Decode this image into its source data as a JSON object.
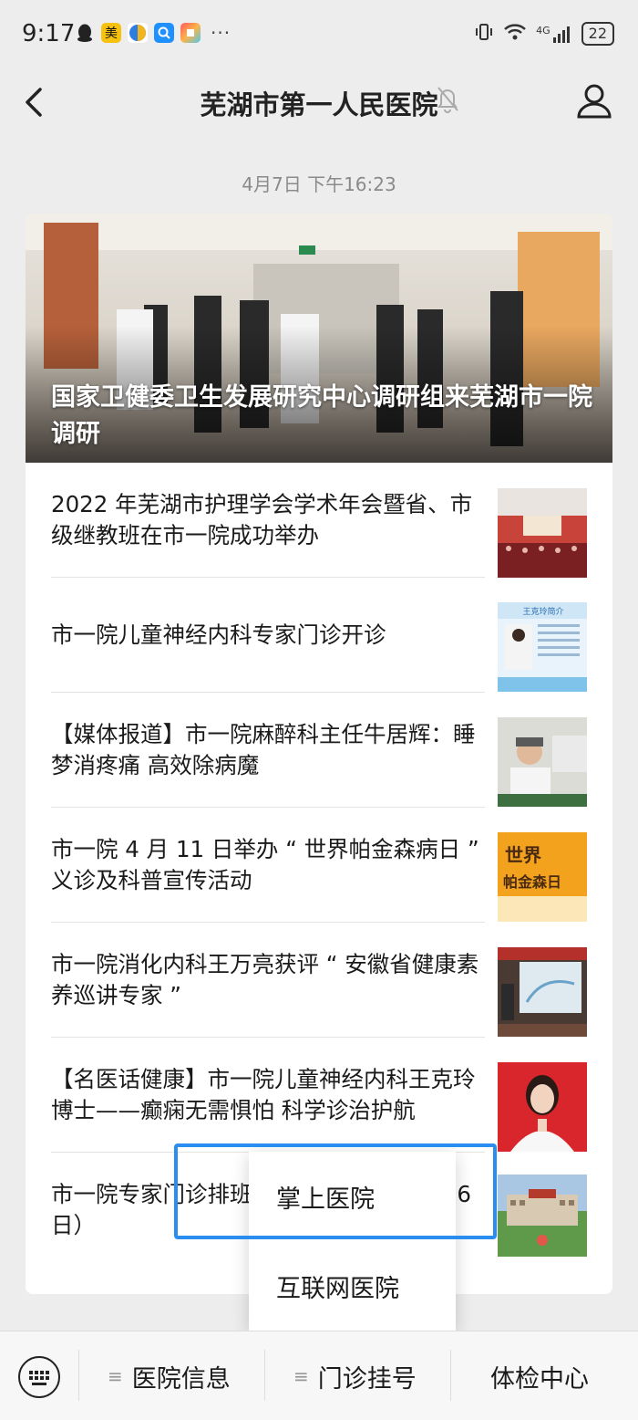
{
  "status_bar": {
    "time": "9:17",
    "app_icons": [
      {
        "name": "qq-icon",
        "glyph": "●",
        "color": "#222222"
      },
      {
        "name": "meituan-icon",
        "glyph": "美",
        "color": "#f6c20f"
      },
      {
        "name": "browser-icon",
        "glyph": "◑",
        "color": "#2f7de1"
      },
      {
        "name": "search-app-icon",
        "glyph": "Q",
        "color": "#1e90ff"
      },
      {
        "name": "app-store-icon",
        "glyph": "◆",
        "color": "#ff5a5f"
      }
    ],
    "more": "···",
    "network": "4G",
    "battery": "22"
  },
  "header": {
    "title": "芜湖市第一人民医院"
  },
  "timestamp": "4月7日 下午16:23",
  "hero": {
    "caption": "国家卫健委卫生发展研究中心调研组来芜湖市一院调研"
  },
  "articles": [
    {
      "title": "2022 年芜湖市护理学会学术年会暨省、市级继教班在市一院成功举办",
      "thumb": "conference-hall"
    },
    {
      "title": "市一院儿童神经内科专家门诊开诊",
      "thumb": "doctor-profile-poster",
      "thumb_text": "王克玲简介"
    },
    {
      "title": "【媒体报道】市一院麻醉科主任牛居辉：睡梦消疼痛 高效除病魔",
      "thumb": "doctor-interview"
    },
    {
      "title": "市一院 4 月 11 日举办 “ 世界帕金森病日 ” 义诊及科普宣传活动",
      "thumb": "parkinsons-day-poster",
      "thumb_text_1": "世界",
      "thumb_text_2": "帕金森日"
    },
    {
      "title": "市一院消化内科王万亮获评 “ 安徽省健康素养巡讲专家 ”",
      "thumb": "lecture-slide"
    },
    {
      "title": "【名医话健康】市一院儿童神经内科王克玲博士——癫痫无需惧怕  科学诊治护航",
      "thumb": "doctor-portrait"
    },
    {
      "title": "市一院专家门诊排班表（4月11日—4月16日）",
      "thumb": "hospital-building"
    }
  ],
  "popup_menu": {
    "items": [
      "掌上医院",
      "互联网医院"
    ]
  },
  "bottom_menu": {
    "tabs": [
      "医院信息",
      "门诊挂号",
      "体检中心"
    ]
  },
  "colors": {
    "highlight": "#2a8df0",
    "background": "#ededed"
  }
}
